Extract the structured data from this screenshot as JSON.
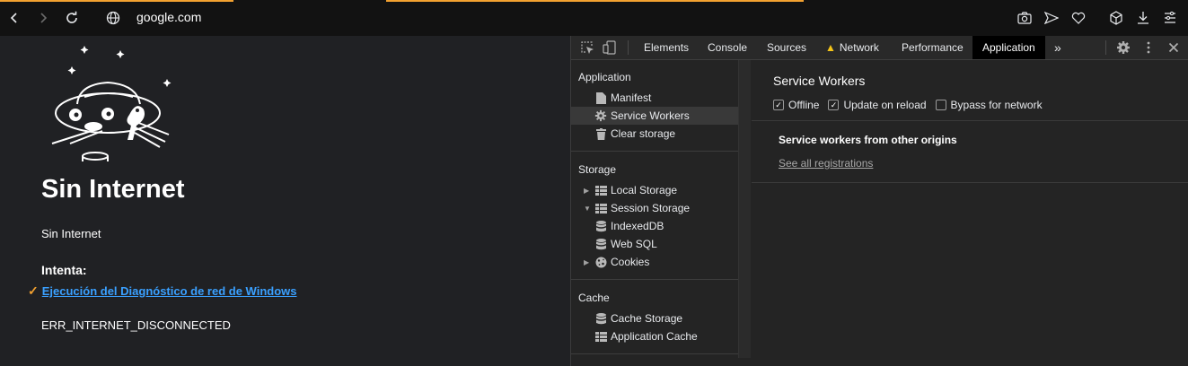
{
  "browser": {
    "url": "google.com",
    "nav": [
      "back-icon",
      "forward-icon",
      "reload-icon",
      "globe-icon"
    ],
    "toolbar_icons": [
      "camera-icon",
      "send-icon",
      "heart-icon",
      "cube-icon",
      "download-icon",
      "menu-icon"
    ],
    "accent": "#f2a130"
  },
  "page": {
    "title": "Sin Internet",
    "subtitle": "Sin Internet",
    "try_heading": "Intenta:",
    "suggestion_check": "✓",
    "suggestion_link": "Ejecución del Diagnóstico de red de Windows",
    "error_code": "ERR_INTERNET_DISCONNECTED",
    "link_color": "#3aa0ff"
  },
  "devtools": {
    "tabs": [
      "Elements",
      "Console",
      "Sources",
      "Network",
      "Performance",
      "Application"
    ],
    "active_tab": "Application",
    "more_tabs": "»",
    "sidebar": {
      "application_head": "Application",
      "application_items": [
        "Manifest",
        "Service Workers",
        "Clear storage"
      ],
      "selected_item": "Service Workers",
      "storage_head": "Storage",
      "storage_items": [
        "Local Storage",
        "Session Storage",
        "IndexedDB",
        "Web SQL",
        "Cookies"
      ],
      "cache_head": "Cache",
      "cache_items": [
        "Cache Storage",
        "Application Cache"
      ]
    },
    "main": {
      "title": "Service Workers",
      "options": [
        {
          "label": "Offline",
          "checked": true
        },
        {
          "label": "Update on reload",
          "checked": true
        },
        {
          "label": "Bypass for network",
          "checked": false
        }
      ],
      "origins_title": "Service workers from other origins",
      "see_all": "See all registrations"
    }
  }
}
